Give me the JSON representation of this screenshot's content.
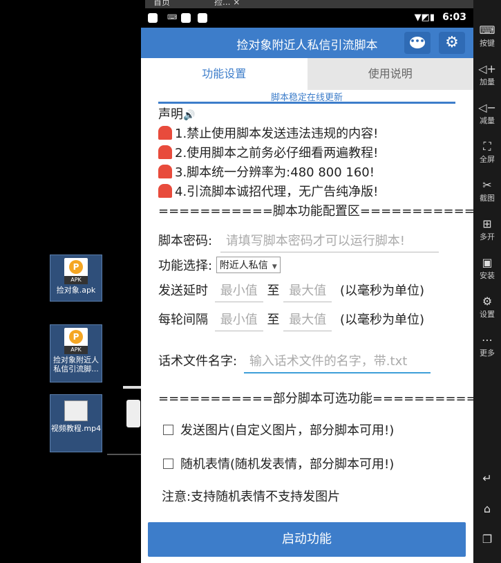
{
  "host": {
    "tab1": "首页",
    "tab2": "捡...",
    "tab2_close": "×"
  },
  "desktop": {
    "icon1": {
      "label": "捡对象.apk",
      "badge": "APK"
    },
    "icon2": {
      "label": "捡对象附近人私信引流脚...",
      "badge": "APK"
    },
    "icon3": {
      "label": "视频教程.mp4"
    }
  },
  "statusbar": {
    "kb": "⌨",
    "time": "6:03",
    "icons": "▼◩▮"
  },
  "app": {
    "title": "捡对象附近人私信引流脚本"
  },
  "tabs": [
    {
      "label": "功能设置"
    },
    {
      "label": "使用说明"
    }
  ],
  "update_note": "脚本稳定在线更新",
  "notice": {
    "heading": "声明",
    "items": [
      "1.禁止使用脚本发送违法违规的内容!",
      "2.使用脚本之前务必仔细看两遍教程!",
      "3.脚本统一分辨率为:480  800  160!",
      "4.引流脚本诚招代理，无广告纯净版!"
    ],
    "config_divider": "===========脚本功能配置区==========="
  },
  "form": {
    "password_label": "脚本密码:",
    "password_placeholder": "请填写脚本密码才可以运行脚本!",
    "function_label": "功能选择:",
    "function_value": "附近人私信",
    "delay_label": "发送延时",
    "interval_label": "每轮间隔",
    "min_placeholder": "最小值",
    "to": "至",
    "max_placeholder": "最大值",
    "unit": "(以毫秒为单位)",
    "script_file_label": "话术文件名字:",
    "script_file_placeholder": "输入话术文件的名字，带.txt",
    "optional_divider": "===========部分脚本可选功能===========",
    "send_image": "发送图片(自定义图片，部分脚本可用!)",
    "random_emoji": "随机表情(随机发表情，部分脚本可用!)",
    "note": "注意:支持随机表情不支持发图片"
  },
  "start_button": "启动功能",
  "right_toolbar": [
    {
      "icon": "keyboard-icon",
      "label": "按键"
    },
    {
      "icon": "volume-up-icon",
      "label": "加量"
    },
    {
      "icon": "volume-down-icon",
      "label": "减量"
    },
    {
      "icon": "fullscreen-icon",
      "label": "全屏"
    },
    {
      "icon": "scissors-icon",
      "label": "截图"
    },
    {
      "icon": "multi-open-icon",
      "label": "多开"
    },
    {
      "icon": "apk-install-icon",
      "label": "安装"
    },
    {
      "icon": "settings-icon",
      "label": "设置"
    },
    {
      "icon": "more-icon",
      "label": "更多"
    }
  ]
}
